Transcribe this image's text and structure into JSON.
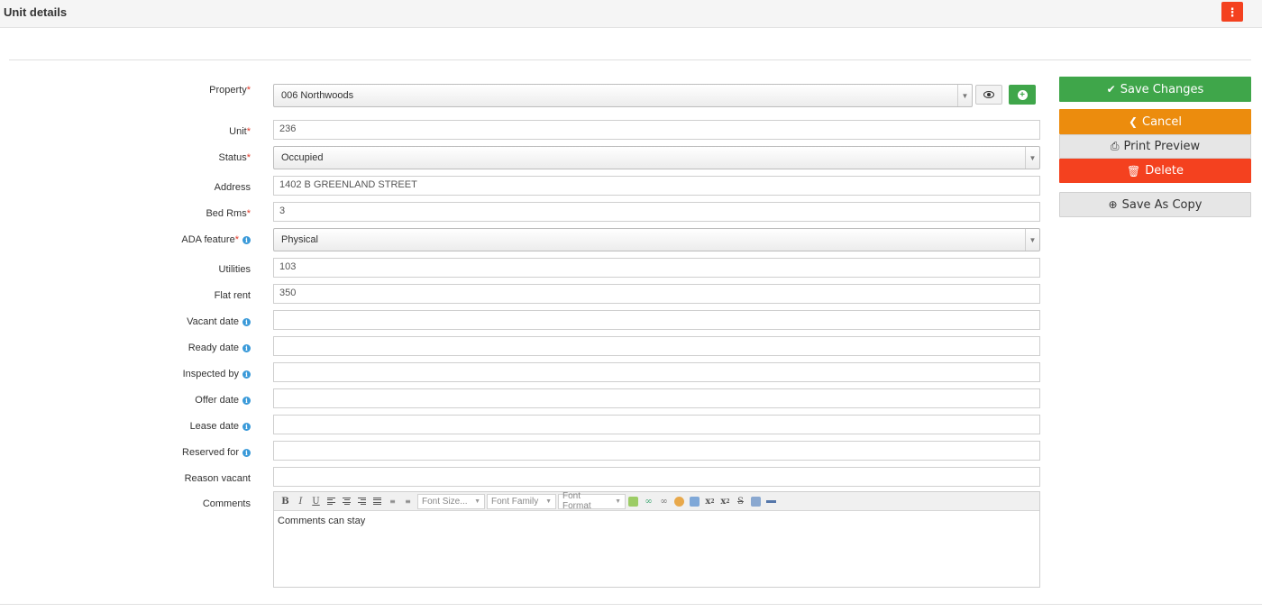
{
  "header": {
    "title": "Unit details",
    "menu_icon": "kebab-icon"
  },
  "form": {
    "property": {
      "label": "Property",
      "value": "006 Northwoods",
      "required": true
    },
    "unit": {
      "label": "Unit",
      "value": "236",
      "required": true
    },
    "status": {
      "label": "Status",
      "value": "Occupied",
      "required": true
    },
    "address": {
      "label": "Address",
      "value": "1402 B GREENLAND STREET"
    },
    "bed_rms": {
      "label": "Bed Rms",
      "value": "3",
      "required": true
    },
    "ada_feature": {
      "label": "ADA feature",
      "value": "Physical",
      "required": true,
      "info": true
    },
    "utilities": {
      "label": "Utilities",
      "value": "103"
    },
    "flat_rent": {
      "label": "Flat rent",
      "value": "350"
    },
    "vacant_date": {
      "label": "Vacant date",
      "value": "",
      "info": true
    },
    "ready_date": {
      "label": "Ready date",
      "value": "",
      "info": true
    },
    "inspected_by": {
      "label": "Inspected by",
      "value": "",
      "info": true
    },
    "offer_date": {
      "label": "Offer date",
      "value": "",
      "info": true
    },
    "lease_date": {
      "label": "Lease date",
      "value": "",
      "info": true
    },
    "reserved_for": {
      "label": "Reserved for",
      "value": "",
      "info": true
    },
    "reason_vacant": {
      "label": "Reason vacant",
      "value": ""
    },
    "comments": {
      "label": "Comments",
      "value": "Comments can stay",
      "toolbar": {
        "font_size": "Font Size...",
        "font_family": "Font Family",
        "font_format": "Font Format"
      }
    },
    "required_marker": "*"
  },
  "actions": {
    "save_changes": "Save Changes",
    "cancel": "Cancel",
    "print_preview": "Print Preview",
    "delete": "Delete",
    "save_as_copy": "Save As Copy"
  },
  "colors": {
    "save": "#3fa64a",
    "cancel": "#ec8c0d",
    "delete": "#f4411f",
    "neutral": "#e6e6e6",
    "required": "#e23a2a",
    "info": "#3a9ad9"
  }
}
